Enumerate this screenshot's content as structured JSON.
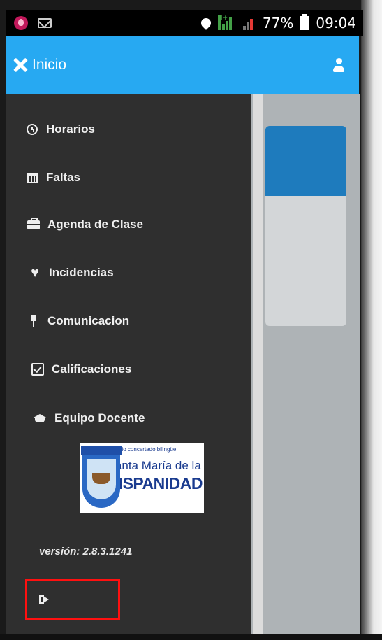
{
  "status_bar": {
    "network_label": "H+",
    "battery": "77%",
    "time": "09:04"
  },
  "header": {
    "title": "Inicio"
  },
  "menu": {
    "items": [
      {
        "label": "Horarios",
        "icon": "clock-icon"
      },
      {
        "label": "Faltas",
        "icon": "calendar-icon"
      },
      {
        "label": "Agenda de Clase",
        "icon": "briefcase-icon"
      },
      {
        "label": "Incidencias",
        "icon": "heart-icon"
      },
      {
        "label": "Comunicacion",
        "icon": "pin-icon"
      },
      {
        "label": "Calificaciones",
        "icon": "check-square-icon"
      },
      {
        "label": "Equipo Docente",
        "icon": "graduation-cap-icon"
      }
    ]
  },
  "logo": {
    "line1": "Colegio concertado bilingüe",
    "line2": "Santa María de la",
    "line3": "HISPANIDAD"
  },
  "version": "versión: 2.8.3.1241",
  "colors": {
    "header": "#27a9f2",
    "drawer": "#2f2f2f",
    "highlight": "#ff1010"
  }
}
